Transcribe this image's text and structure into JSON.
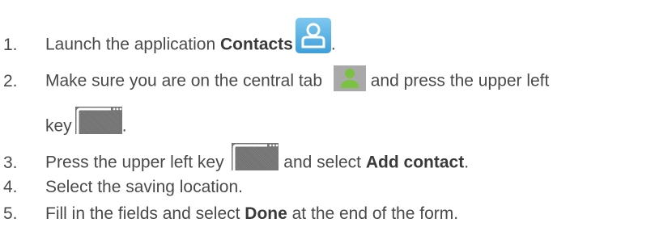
{
  "steps": [
    {
      "num": "1.",
      "pre": "Launch the application ",
      "bold": "Contacts",
      "post": "."
    },
    {
      "num": "2.",
      "pre": "Make sure you are on the central tab ",
      "post": " and press the upper left",
      "cont": "key",
      "cont_post": "."
    },
    {
      "num": "3.",
      "pre": "Press the upper left key ",
      "mid": " and select ",
      "bold": "Add contact",
      "post": "."
    },
    {
      "num": "4.",
      "text": "Select the saving location."
    },
    {
      "num": "5.",
      "pre": "Fill in the fields and select ",
      "bold": "Done",
      "post": " at the end of the form."
    }
  ],
  "icons": [
    "contacts-app-icon",
    "contacts-tab-icon",
    "menu-key-icon"
  ],
  "colors": {
    "text": "#4a4a4a",
    "contacts_icon": "#3f9fd9",
    "tab_icon": "#7cc242",
    "key": "#6f6f6f"
  }
}
